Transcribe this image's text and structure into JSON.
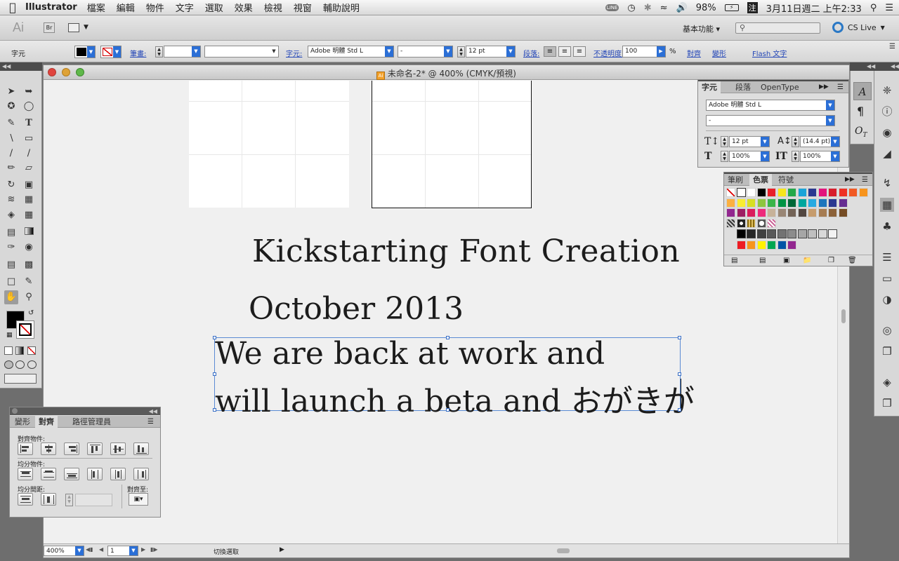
{
  "menubar": {
    "app_name": "Illustrator",
    "menus": [
      "檔案",
      "編輯",
      "物件",
      "文字",
      "選取",
      "效果",
      "檢視",
      "視窗",
      "輔助說明"
    ],
    "status": {
      "line_badge": "LINE",
      "battery": "98%",
      "input_method": "注",
      "datetime": "3月11日週二 上午2:33"
    }
  },
  "appbar": {
    "logo": "Ai",
    "bridge": "Br",
    "workspace": "基本功能 ▾",
    "search_placeholder": "",
    "cs_live": "CS Live"
  },
  "controlbar": {
    "panel_label": "字元",
    "stroke_label": "筆畫:",
    "char_label": "字元:",
    "font_family": "Adobe 明體 Std L",
    "font_style": "-",
    "font_size": "12 pt",
    "paragraph_label": "段落:",
    "opacity_label": "不透明度:",
    "opacity_value": "100",
    "opacity_unit": "%",
    "align_label": "對齊",
    "transform_label": "變形",
    "flash_text_label": "Flash 文字"
  },
  "document": {
    "title": "未命名-2* @ 400% (CMYK/預視)",
    "headline": "Kickstarting Font Creation",
    "date_line": "October 2013",
    "body_line1": "We are back at work and",
    "body_line2": "will launch a beta and おがきが"
  },
  "statusbar": {
    "zoom": "400%",
    "artboard_num": "1",
    "status_text": "切換選取"
  },
  "character_panel": {
    "tabs": [
      "字元",
      "段落",
      "OpenType"
    ],
    "font_family": "Adobe 明體 Std L",
    "font_style": "-",
    "size": "12 pt",
    "leading": "(14.4 pt)",
    "h_scale": "100%",
    "v_scale": "100%"
  },
  "swatches_panel": {
    "tabs": [
      "筆刷",
      "色票",
      "符號"
    ],
    "colors_row1": [
      "#ffffff",
      "#000000",
      "#e8202a",
      "#f7e61d",
      "#24a84a",
      "#1aa3d8",
      "#2b3990",
      "#e3137c",
      "#d81e2c",
      "#ee3124",
      "#f15a24",
      "#f7941d"
    ],
    "colors_row2": [
      "#fbb040",
      "#f9ed32",
      "#d7df23",
      "#8dc63f",
      "#39b54a",
      "#009444",
      "#006838",
      "#00a79d",
      "#27aae1",
      "#1c75bc",
      "#2b3990",
      "#662d91"
    ],
    "colors_row3": [
      "#92278f",
      "#9e1f63",
      "#da1c5c",
      "#ee2a7b",
      "#c7b299",
      "#998675",
      "#736357",
      "#534741",
      "#c69c6d",
      "#a67c52",
      "#8c6239",
      "#754c24"
    ],
    "grays_row": [
      "#000000",
      "#262626",
      "#404040",
      "#595959",
      "#737373",
      "#8c8c8c",
      "#a6a6a6",
      "#bfbfbf",
      "#d9d9d9",
      "#f2f2f2"
    ],
    "bright_row": [
      "#ed1c24",
      "#f7941d",
      "#fff200",
      "#00a651",
      "#0054a6",
      "#92278f"
    ]
  },
  "align_panel": {
    "tabs": [
      "變形",
      "對齊",
      "路徑管理員"
    ],
    "align_objects_label": "對齊物件:",
    "distribute_objects_label": "均分物件:",
    "distribute_spacing_label": "均分間距:",
    "align_to_label": "對齊至:"
  },
  "colors": {
    "selection": "#3a6fc6",
    "accent_blue": "#2b6fd6"
  }
}
